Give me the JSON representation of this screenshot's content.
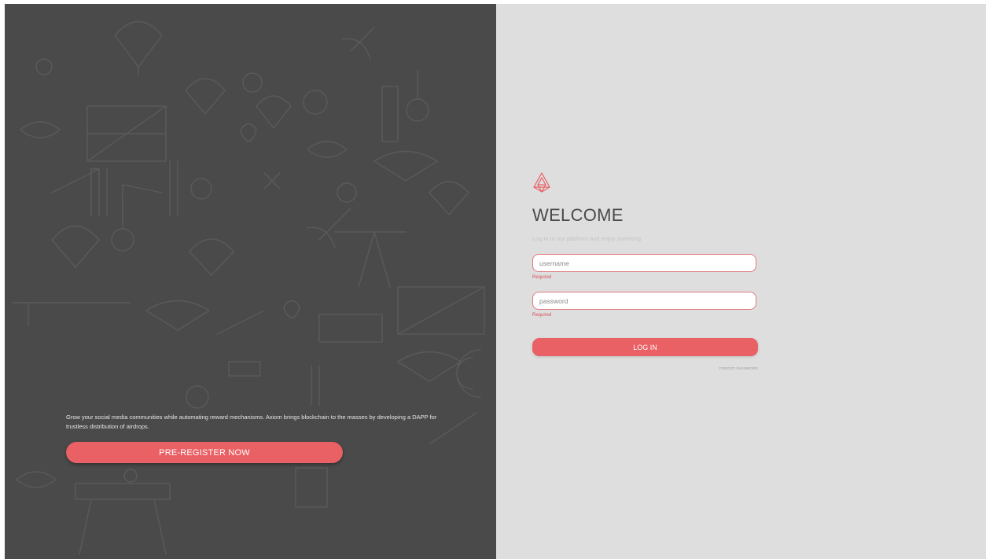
{
  "promo": {
    "text": "Grow your social media communities while automating reward mechanisms. Axiom brings blockchain to the masses by developing a DAPP for trustless distribution of airdrops.",
    "button_label": "PRE-REGISTER NOW"
  },
  "login": {
    "logo_icon": "axiom-triangle-logo-icon",
    "title": "WELCOME",
    "subtitle": "Log in to our platform and enjoy someting",
    "username_placeholder": "username",
    "username_error": "Required",
    "password_placeholder": "password",
    "password_error": "Required",
    "submit_label": "LOG IN",
    "forgot_label": "FORGOT PASSWORD"
  },
  "colors": {
    "accent": "#e96065",
    "left_bg": "#4a4a4a",
    "right_bg": "#dedede",
    "error": "#d9535b"
  }
}
